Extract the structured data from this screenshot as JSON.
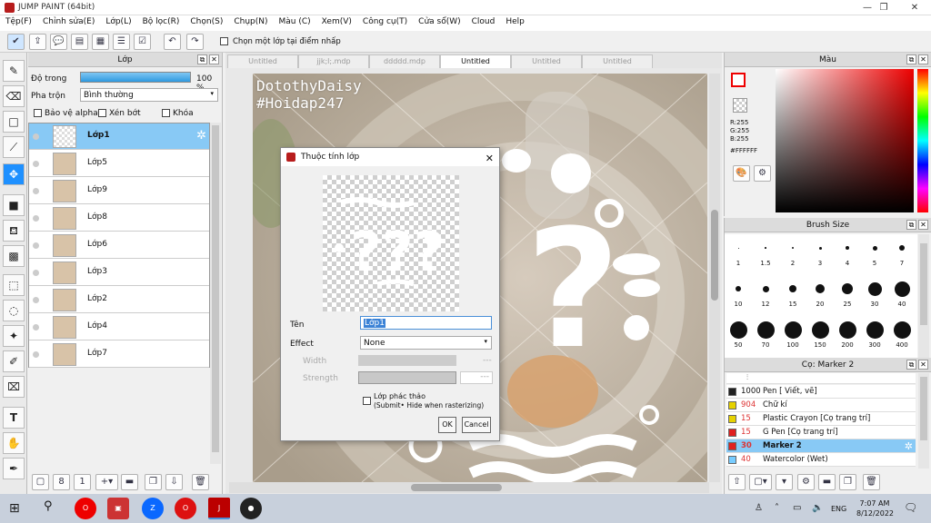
{
  "app": {
    "title": "JUMP PAINT (64bit)"
  },
  "menu": [
    "Tệp(F)",
    "Chỉnh sửa(E)",
    "Lớp(L)",
    "Bộ lọc(R)",
    "Chọn(S)",
    "Chụp(N)",
    "Màu (C)",
    "Xem(V)",
    "Công cụ(T)",
    "Cửa sổ(W)",
    "Cloud",
    "Help"
  ],
  "toolbar": {
    "option_label": "Chọn một lớp tại điểm nhấp"
  },
  "layer_panel": {
    "title": "Lớp",
    "opacity_label": "Độ trong",
    "opacity_value": "100 %",
    "opacity_fill": 1.0,
    "blend_label": "Pha trộn",
    "blend_value": "Bình thường",
    "protect_alpha": "Bảo vệ alpha",
    "clipping": "Xén bớt",
    "lock": "Khóa",
    "layers": [
      "Lớp1",
      "Lớp5",
      "Lớp9",
      "Lớp8",
      "Lớp6",
      "Lớp3",
      "Lớp2",
      "Lớp4",
      "Lớp7"
    ],
    "selected": 0
  },
  "tabs": [
    "Untitled",
    "jjk;l;.mdp",
    "ddddd.mdp",
    "Untitled",
    "Untitled",
    "Untitled"
  ],
  "active_tab": 3,
  "canvas": {
    "watermark1": "DotothyDaisy",
    "watermark2": "#Hoidap247"
  },
  "dialog": {
    "title": "Thuộc tính lớp",
    "name_label": "Tên",
    "name_value": "Lớp1",
    "effect_label": "Effect",
    "effect_value": "None",
    "width_label": "Width",
    "width_value": "---",
    "strength_label": "Strength",
    "strength_value": "---",
    "draft_label": "Lớp phác thảo",
    "draft_sub": "(Submit• Hide when rasterizing)",
    "ok": "OK",
    "cancel": "Cancel"
  },
  "color_panel": {
    "title": "Màu",
    "r": "R:255",
    "g": "G:255",
    "b": "B:255",
    "hex": "#FFFFFF"
  },
  "brush_size": {
    "title": "Brush Size",
    "sizes": [
      "1",
      "1.5",
      "2",
      "3",
      "4",
      "5",
      "7",
      "10",
      "12",
      "15",
      "20",
      "25",
      "30",
      "40",
      "50",
      "70",
      "100",
      "150",
      "200",
      "300",
      "400"
    ]
  },
  "brush_panel": {
    "title": "Cọ: Marker 2",
    "items": [
      {
        "size": "1000",
        "name": "Pen [ Viết, vẽ]",
        "color": "#222222"
      },
      {
        "size": "904",
        "name": "Chữ kí",
        "color": "#e6d200"
      },
      {
        "size": "15",
        "name": "Plastic Crayon [Cọ trang trí]",
        "color": "#e6d200"
      },
      {
        "size": "15",
        "name": "G Pen [Cọ trang trí]",
        "color": "#e02020"
      },
      {
        "size": "30",
        "name": "Marker 2",
        "color": "#e02020"
      },
      {
        "size": "40",
        "name": "Watercolor (Wet)",
        "color": "#77ccff"
      }
    ],
    "selected": 4
  },
  "taskbar": {
    "time": "7:07 AM",
    "date": "8/12/2022",
    "lang": "ENG"
  }
}
